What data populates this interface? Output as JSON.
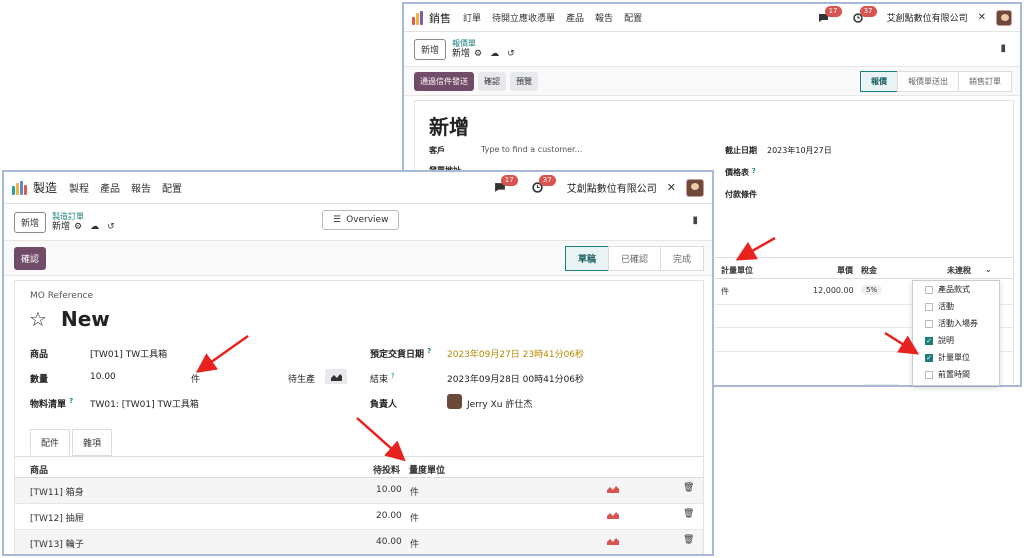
{
  "sales": {
    "app_name": "銷售",
    "nav": [
      "訂單",
      "待開立應收憑單",
      "產品",
      "報告",
      "配置"
    ],
    "chat_count": "17",
    "activity_count": "37",
    "company": "艾創點數位有限公司",
    "new_button": "新增",
    "breadcrumb_parent": "報價單",
    "breadcrumb_current": "新增",
    "actions": {
      "send_email": "通過信件發送",
      "confirm": "確認",
      "preview": "預覽"
    },
    "stages": [
      "報價",
      "報價單送出",
      "銷售訂單"
    ],
    "record_title": "新增",
    "fields": {
      "customer_label": "客戶",
      "customer_placeholder": "Type to find a customer...",
      "invoice_address_label": "發票地址",
      "expiration_label": "截止日期",
      "expiration_value": "2023年10月27日",
      "pricelist_label": "價格表",
      "payment_terms_label": "付款條件"
    },
    "lines_header": {
      "uom": "計量單位",
      "price": "單價",
      "tax": "稅金",
      "subtotal": "未連稅"
    },
    "line": {
      "uom": "件",
      "price": "12,000.00",
      "tax": "5%"
    },
    "column_menu": [
      {
        "label": "產品款式",
        "checked": false
      },
      {
        "label": "活動",
        "checked": false
      },
      {
        "label": "活動入場券",
        "checked": false
      },
      {
        "label": "說明",
        "checked": true
      },
      {
        "label": "計量單位",
        "checked": true
      },
      {
        "label": "前置時間",
        "checked": false
      }
    ]
  },
  "mfg": {
    "app_name": "製造",
    "nav": [
      "製程",
      "產品",
      "報告",
      "配置"
    ],
    "chat_count": "17",
    "activity_count": "37",
    "company": "艾創點數位有限公司",
    "new_button": "新增",
    "breadcrumb_parent": "製造訂單",
    "breadcrumb_current": "新增",
    "overview_button": "Overview",
    "confirm_button": "確認",
    "stages": [
      "草稿",
      "已確認",
      "完成"
    ],
    "mo_reference_label": "MO Reference",
    "record_title": "New",
    "fields": {
      "product_label": "商品",
      "product_value": "[TW01] TW工具箱",
      "quantity_label": "數量",
      "quantity_value": "10.00",
      "quantity_uom": "件",
      "to_produce_label": "待生產",
      "bom_label": "物料清單",
      "bom_value": "TW01: [TW01] TW工具箱",
      "scheduled_label": "預定交貨日期",
      "scheduled_value": "2023年09月27日 23時41分06秒",
      "end_label": "結束",
      "end_value": "2023年09月28日 00時41分06秒",
      "responsible_label": "負責人",
      "responsible_value": "Jerry Xu 許仕杰"
    },
    "tabs": [
      "配件",
      "雜項"
    ],
    "table_header": {
      "product": "商品",
      "to_consume": "待投料",
      "uom": "量度單位"
    },
    "rows": [
      {
        "product": "[TW11] 箱身",
        "qty": "10.00",
        "uom": "件"
      },
      {
        "product": "[TW12] 抽屜",
        "qty": "20.00",
        "uom": "件"
      },
      {
        "product": "[TW13] 輪子",
        "qty": "40.00",
        "uom": "件"
      }
    ]
  }
}
